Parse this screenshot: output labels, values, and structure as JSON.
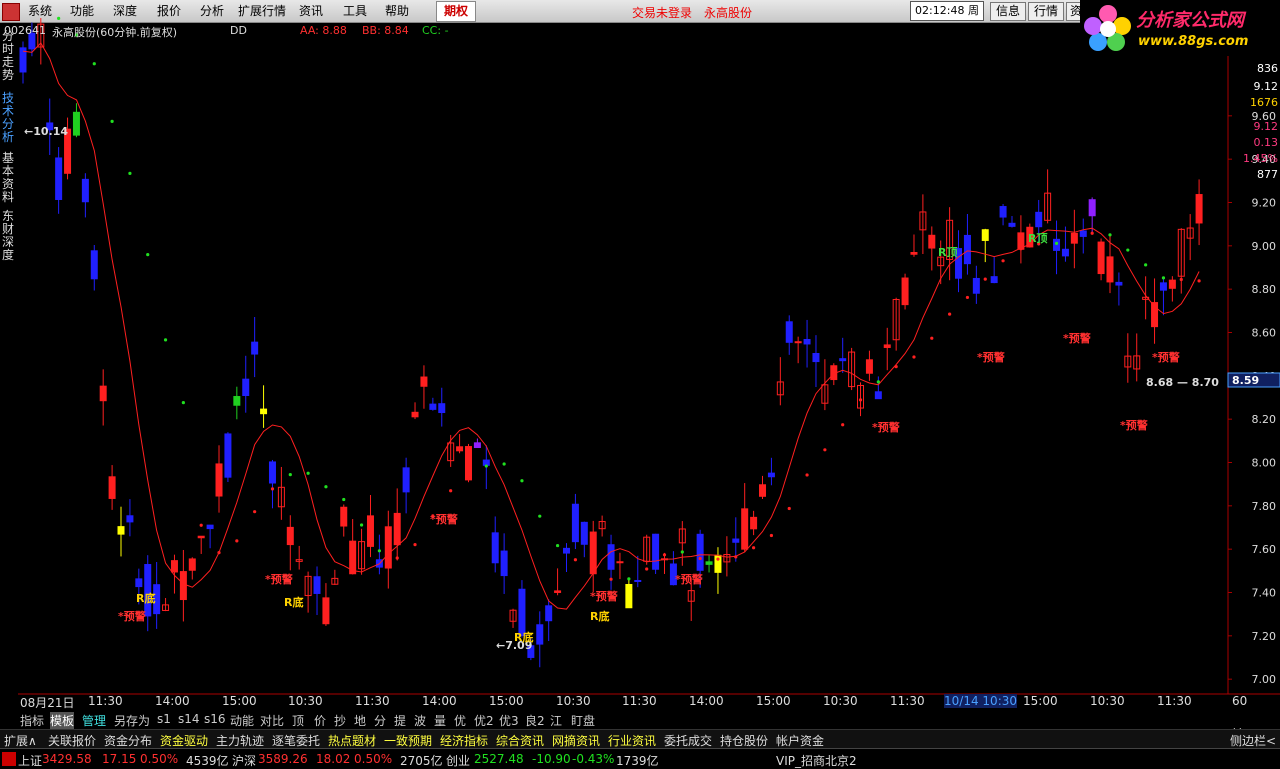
{
  "menu": {
    "items": [
      "系统",
      "功能",
      "深度",
      "报价",
      "分析",
      "扩展行情",
      "资讯",
      "工具",
      "帮助"
    ],
    "active": "期权",
    "login_text": "交易未登录",
    "stock_name": "永高股份",
    "time": "02:12:48",
    "weekday": "周二",
    "info_btn": "信息",
    "quote_btn": "行情",
    "res_btn": "资"
  },
  "logo": {
    "title": "分析家公式网",
    "url": "www.88gs.com"
  },
  "header": {
    "code": "002641",
    "title": "永高股份(60分钟.前复权)",
    "dd": "DD",
    "aa": "AA: 8.88",
    "bb": "BB: 8.84",
    "cc": "CC: -"
  },
  "leftnav": [
    "分时走势",
    "技术分析",
    "基本资料",
    "东财深度"
  ],
  "right_panel": [
    "836",
    "9.12",
    "1676",
    "9.12",
    "0.13",
    "1.45%",
    "877"
  ],
  "colors": {
    "up": "#ff2020",
    "down": "#2020ff",
    "yellow": "#ffff00",
    "green": "#20d020",
    "purple": "#9020ff",
    "cyan": "#40e0e0"
  },
  "chart_data": {
    "type": "candlestick",
    "y_ticks": [
      "9.60",
      "9.40",
      "9.20",
      "9.00",
      "8.80",
      "8.60",
      "8.40",
      "8.20",
      "8.00",
      "7.80",
      "7.60",
      "7.40",
      "7.20",
      "7.00"
    ],
    "ylim": [
      6.95,
      9.95
    ],
    "x_ticks": [
      "08月21日",
      "11:30",
      "14:00",
      "15:00",
      "10:30",
      "11:30",
      "14:00",
      "15:00",
      "10:30",
      "11:30",
      "14:00",
      "15:00",
      "10:30",
      "11:30",
      "10/14",
      "10:30",
      "15:00",
      "10:30",
      "11:30"
    ],
    "x_unit": "60分钟",
    "annotations": {
      "high_label": "10.14",
      "low_label": "7.09",
      "range_label": "8.68 — 8.70",
      "current_price": "8.59",
      "top_labels": [
        "R顶",
        "R顶"
      ],
      "bottom_labels": [
        "R底",
        "R底",
        "R底",
        "R底"
      ],
      "warning_labels": [
        "预警",
        "预警",
        "预警",
        "预警",
        "预警",
        "预警",
        "预警",
        "预警",
        "预警",
        "预警"
      ]
    }
  },
  "bottom_tabs": [
    "指标",
    "模板",
    "管理",
    "另存为",
    "s1",
    "s14",
    "s16",
    "动能",
    "对比",
    "顶",
    "价",
    "抄",
    "地",
    "分",
    "提",
    "波",
    "量",
    "优",
    "优2",
    "优3",
    "良2",
    "江",
    "盯盘"
  ],
  "feature_tabs": [
    "扩展∧",
    "关联报价",
    "资金分布",
    "资金驱动",
    "主力轨迹",
    "逐笔委托",
    "热点题材",
    "一致预期",
    "经济指标",
    "综合资讯",
    "网摘资讯",
    "行业资讯",
    "委托成交",
    "持仓股份",
    "帐户资金"
  ],
  "side_toggle": "侧边栏<",
  "status": {
    "sh_label": "上证",
    "sh_value": "3429.58",
    "sh_change": "17.15",
    "sh_pct": "0.50%",
    "sh_amount": "4539亿",
    "sz_label": "沪深",
    "sz_value": "3589.26",
    "sz_change": "18.02",
    "sz_pct": "0.50%",
    "sz_amount": "2705亿",
    "cy_label": "创业",
    "cy_value": "2527.48",
    "cy_change": "-10.90",
    "cy_pct": "-0.43%",
    "cy_amount": "1739亿",
    "server": "VIP_招商北京2"
  }
}
